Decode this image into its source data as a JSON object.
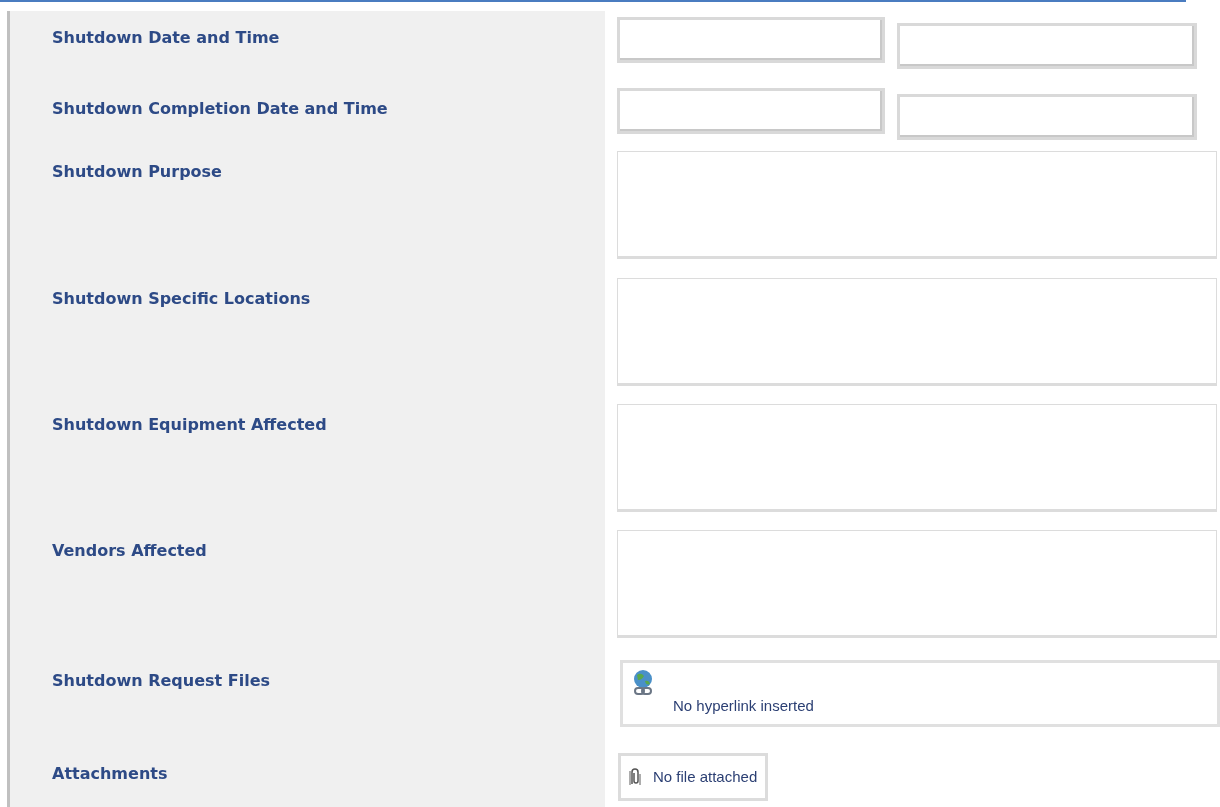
{
  "form": {
    "fields": [
      {
        "label": "Shutdown Date and Time",
        "kind": "datetime"
      },
      {
        "label": "Shutdown Completion Date and Time",
        "kind": "datetime"
      },
      {
        "label": "Shutdown Purpose",
        "kind": "multiline"
      },
      {
        "label": "Shutdown Specific Locations",
        "kind": "multiline"
      },
      {
        "label": "Shutdown Equipment Affected",
        "kind": "multiline"
      },
      {
        "label": "Vendors Affected",
        "kind": "multiline"
      },
      {
        "label": "Shutdown Request Files",
        "kind": "hyperlink",
        "text": "No hyperlink inserted"
      },
      {
        "label": "Attachments",
        "kind": "attachment",
        "text": "No file attached"
      }
    ]
  }
}
